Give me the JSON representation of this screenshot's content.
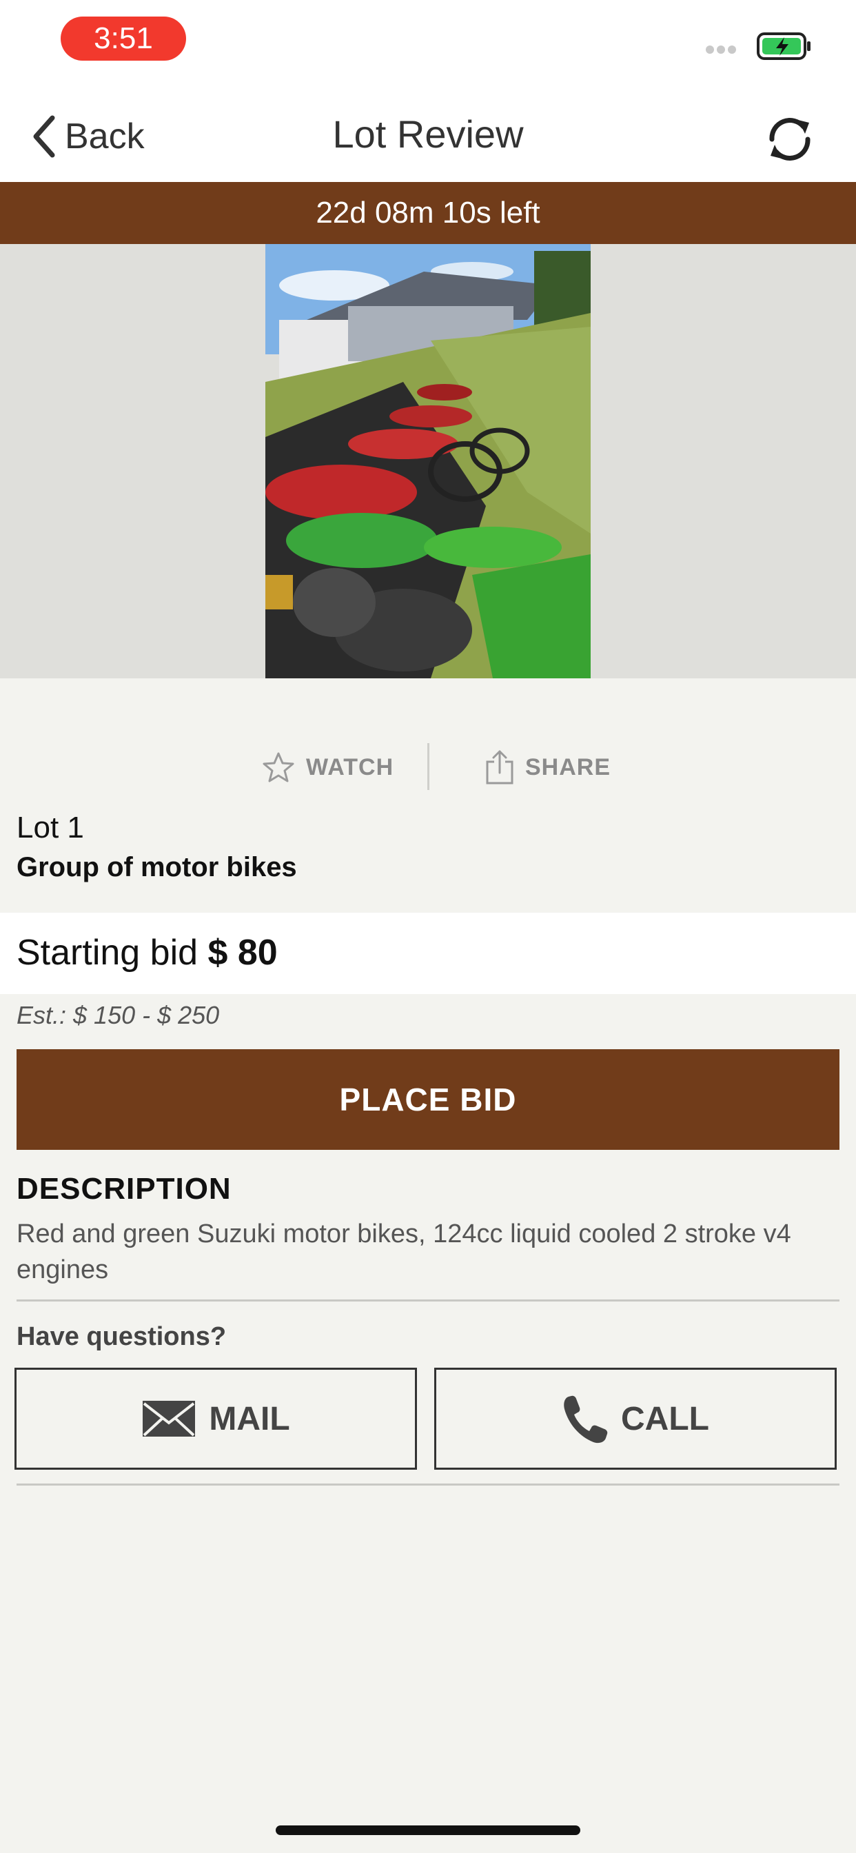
{
  "status_bar": {
    "time": "3:51",
    "battery_color": "#34c759",
    "time_pill_color": "#f2392d"
  },
  "nav": {
    "back_label": "Back",
    "title": "Lot Review"
  },
  "timer": {
    "text": "22d 08m 10s left"
  },
  "actions": {
    "watch_label": "WATCH",
    "share_label": "SHARE"
  },
  "lot": {
    "number": "Lot 1",
    "title": "Group of motor bikes",
    "starting_bid_label": "Starting bid",
    "starting_bid_amount": "$ 80",
    "estimate": "Est.: $ 150 - $ 250"
  },
  "place_bid": {
    "label": "PLACE BID"
  },
  "description": {
    "heading": "DESCRIPTION",
    "text": "Red and green Suzuki motor bikes, 124cc liquid cooled 2 stroke v4 engines"
  },
  "contact": {
    "questions_label": "Have questions?",
    "mail_label": "MAIL",
    "call_label": "CALL"
  },
  "colors": {
    "brand_brown": "#713c1a",
    "background": "#f3f3ef",
    "image_bg": "#dfdfdb"
  },
  "icons": [
    "chevron-left-icon",
    "refresh-icon",
    "star-icon",
    "share-icon",
    "envelope-icon",
    "phone-icon",
    "battery-charging-icon"
  ]
}
